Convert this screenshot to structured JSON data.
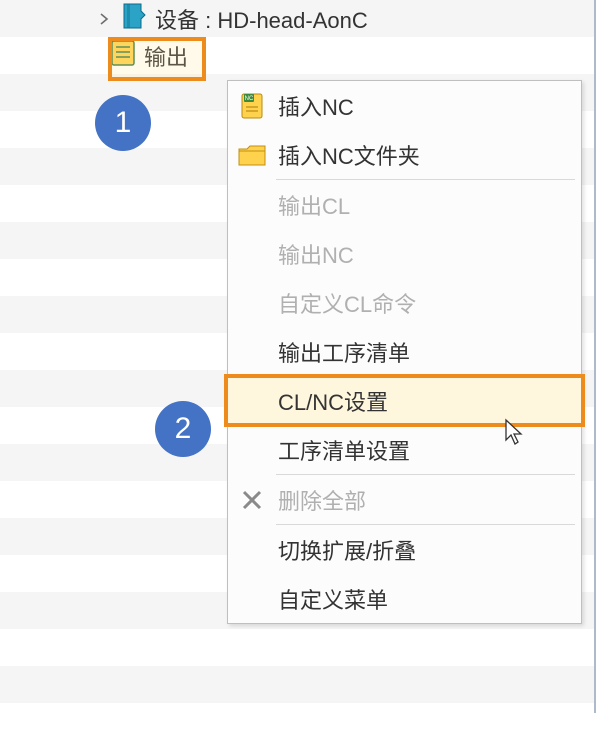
{
  "tree": {
    "device_label": "设备 : HD-head-AonC",
    "output_label": "输出"
  },
  "badges": {
    "one": "1",
    "two": "2"
  },
  "menu": {
    "items": [
      {
        "label": "插入NC",
        "icon": "nc-doc-icon",
        "enabled": true
      },
      {
        "label": "插入NC文件夹",
        "icon": "folder-icon",
        "enabled": true
      },
      {
        "separator": true
      },
      {
        "label": "输出CL",
        "enabled": false
      },
      {
        "label": "输出NC",
        "enabled": false
      },
      {
        "label": "自定义CL命令",
        "enabled": false
      },
      {
        "label": "输出工序清单",
        "enabled": true
      },
      {
        "label": "CL/NC设置",
        "enabled": true,
        "highlighted": true
      },
      {
        "label": "工序清单设置",
        "enabled": true
      },
      {
        "separator": true
      },
      {
        "label": "删除全部",
        "icon": "x-icon",
        "enabled": false
      },
      {
        "separator": true
      },
      {
        "label": "切换扩展/折叠",
        "enabled": true
      },
      {
        "label": "自定义菜单",
        "enabled": true
      }
    ]
  }
}
